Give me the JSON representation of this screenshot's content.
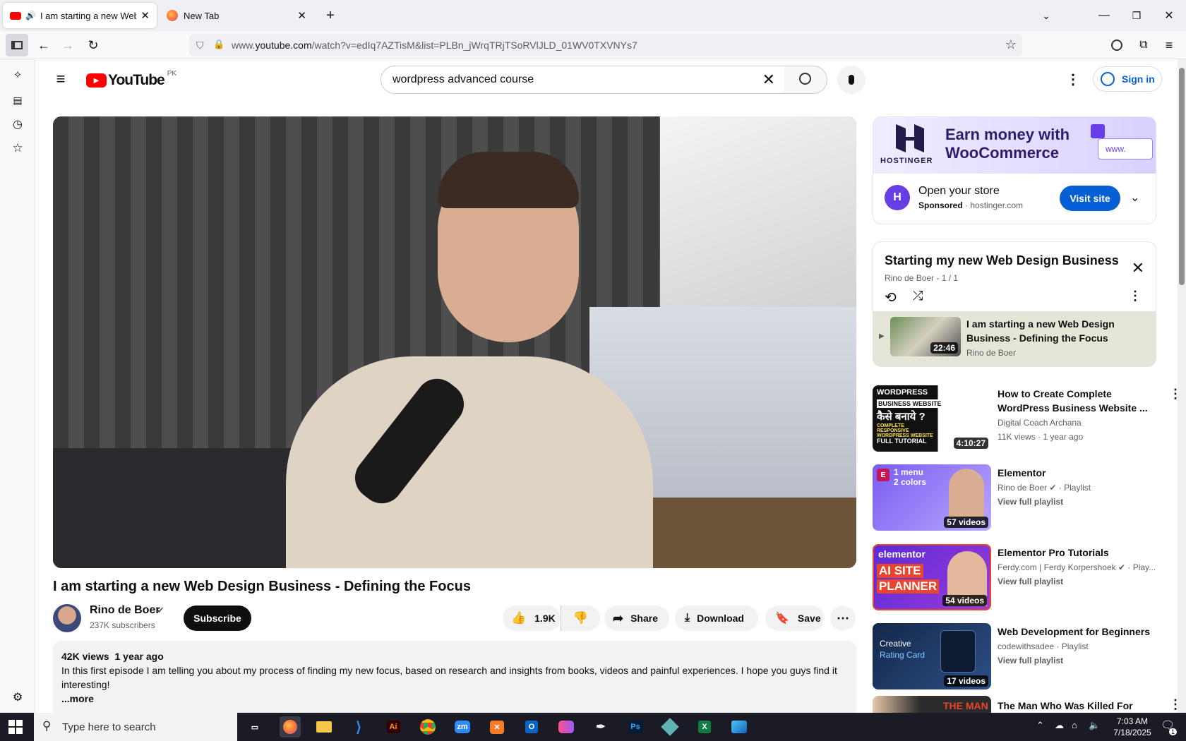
{
  "browser": {
    "tabs": [
      {
        "title": "I am starting a new Web Design Business - Defining the Focus",
        "active": true
      },
      {
        "title": "New Tab",
        "active": false
      }
    ],
    "url_prefix": "www.",
    "url_domain": "youtube.com",
    "url_rest": "/watch?v=edIq7AZTisM&list=PLBn_jWrqTRjTSoRVlJLD_01WV0TXVNYs7"
  },
  "youtube": {
    "logo_text": "YouTube",
    "region": "PK",
    "search_value": "wordpress advanced course",
    "sign_in": "Sign in",
    "video": {
      "title": "I am starting a new Web Design Business - Defining the Focus",
      "channel": "Rino de Boer",
      "subscribers": "237K subscribers",
      "subscribe": "Subscribe",
      "likes": "1.9K",
      "share": "Share",
      "download": "Download",
      "save": "Save",
      "views": "42K views",
      "age": "1 year ago",
      "description": "In this first episode I am telling you about my process of finding my new focus, based on research and insights from books, videos and painful experiences. I hope you guys find it interesting!",
      "more": "...more"
    },
    "ad": {
      "brand": "HOSTINGER",
      "headline": "Earn money with WooCommerce",
      "url_chip": "www.",
      "title": "Open your store",
      "sponsored": "Sponsored",
      "domain": "hostinger.com",
      "cta": "Visit site"
    },
    "playlist": {
      "title": "Starting my new Web Design Business",
      "channel": "Rino de Boer",
      "position": "1 / 1",
      "item_title": "I am starting a new Web Design Business - Defining the Focus",
      "item_channel": "Rino de Boer",
      "item_duration": "22:46"
    },
    "recommendations": [
      {
        "title": "How to Create Complete WordPress Business Website ...",
        "line1": "Digital Coach Archana",
        "line2": "11K views · 1 year ago",
        "badge": "4:10:27",
        "thumb_text": [
          "WORDPRESS",
          "BUSINESS WEBSITE",
          "कैसे बनाये ?",
          "COMPLETE RESPONSIVE WORDPRESS WEBSITE",
          "FULL TUTORIAL"
        ]
      },
      {
        "title": "Elementor",
        "line1": "Rino de Boer",
        "line1b": "· Playlist",
        "line2": "View full playlist",
        "badge": "57 videos",
        "thumb_text": [
          "1 menu",
          "2 colors"
        ]
      },
      {
        "title": "Elementor Pro Tutorials",
        "line1": "Ferdy.com | Ferdy Korpershoek",
        "line1b": "· Play...",
        "line2": "View full playlist",
        "badge": "54 videos",
        "thumb_text": [
          "elementor",
          "AI SITE",
          "PLANNER"
        ]
      },
      {
        "title": "Web Development for Beginners",
        "line1": "codewithsadee",
        "line1b": "· Playlist",
        "line2": "View full playlist",
        "badge": "17 videos",
        "thumb_text": [
          "Creative",
          "Rating Card"
        ]
      },
      {
        "title": "The Man Who Was Killed For",
        "thumb_text": [
          "THE MAN"
        ]
      }
    ]
  },
  "taskbar": {
    "search_placeholder": "Type here to search",
    "time": "7:03 AM",
    "date": "7/18/2025",
    "notifications": "1"
  }
}
